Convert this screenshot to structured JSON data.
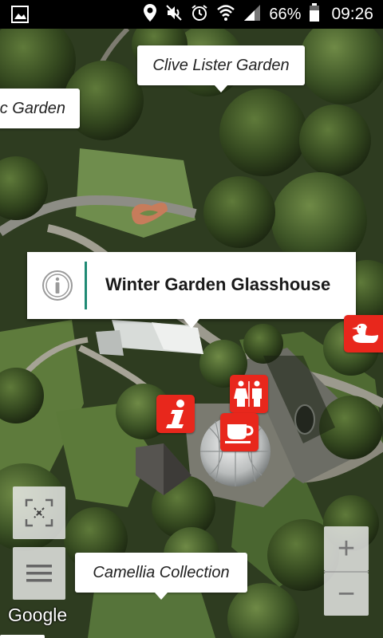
{
  "status_bar": {
    "battery_percent": "66%",
    "time": "09:26",
    "icons": [
      "gallery-icon",
      "location-icon",
      "mute-icon",
      "alarm-icon",
      "wifi-icon",
      "signal-icon",
      "battery-icon"
    ]
  },
  "map": {
    "labels": {
      "clive_lister": "Clive Lister Garden",
      "left_garden": "c Garden",
      "camellia": "Camellia Collection"
    },
    "popup": {
      "title": "Winter Garden Glasshouse",
      "icon": "info-icon"
    },
    "pois": [
      {
        "icon": "duck-icon"
      },
      {
        "icon": "toilets-icon"
      },
      {
        "icon": "information-icon"
      },
      {
        "icon": "cafe-icon"
      }
    ],
    "controls": {
      "zoom_in": "+",
      "zoom_out": "−",
      "locate_icon": "locate-icon",
      "menu_icon": "menu-icon"
    },
    "attribution": "Google",
    "poi_color": "#e8271c",
    "popup_accent": "#1f8a74"
  }
}
